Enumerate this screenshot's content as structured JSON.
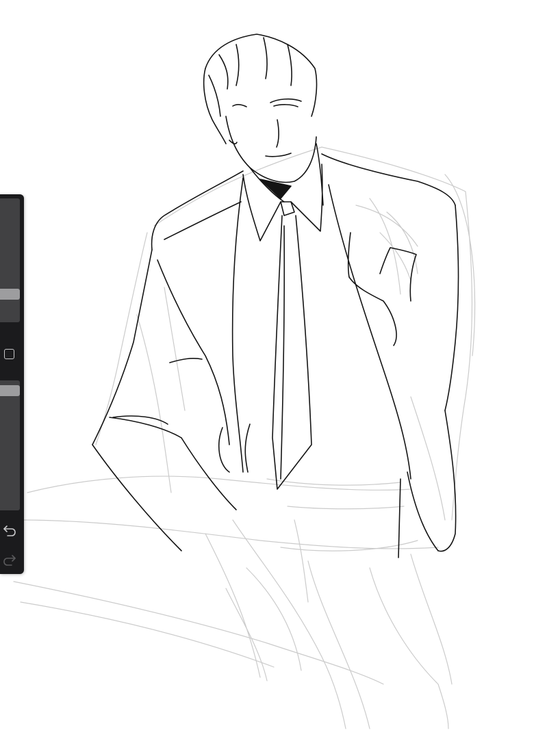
{
  "app": {
    "screen": "drawing-canvas"
  },
  "toolbar": {
    "brush_size": 0.2,
    "brush_opacity": 0.96,
    "icons": {
      "modify": "square-icon",
      "undo": "undo-icon",
      "redo": "redo-icon"
    },
    "colors": {
      "panel": "#1b1b1d",
      "track": "#414143",
      "handle": "#9d9d9f",
      "icon": "#c8c8ca",
      "icon_disabled": "#5a5a5c"
    }
  },
  "canvas": {
    "background": "#ffffff",
    "ink_color": "#111111",
    "sketch_color": "#c9c9c9"
  }
}
